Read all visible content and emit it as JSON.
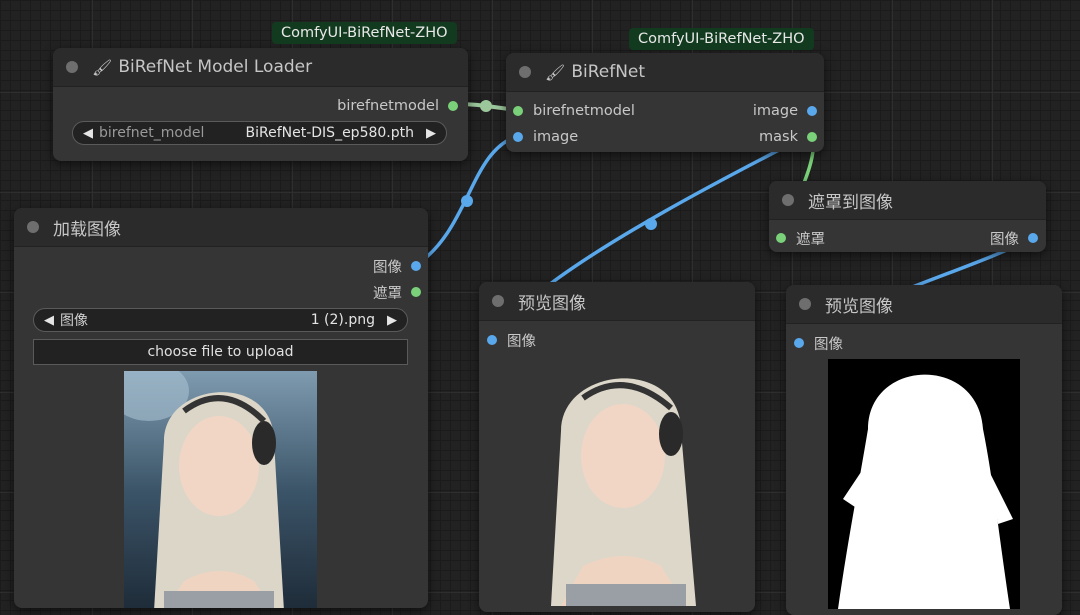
{
  "badges": {
    "loader": "ComfyUI-BiRefNet-ZHO",
    "birefnet": "ComfyUI-BiRefNet-ZHO"
  },
  "loader_node": {
    "title": "BiRefNet Model Loader",
    "output_label": "birefnetmodel",
    "widget_label": "birefnet_model",
    "widget_value": "BiRefNet-DIS_ep580.pth"
  },
  "birefnet_node": {
    "title": "BiRefNet",
    "inputs": [
      "birefnetmodel",
      "image"
    ],
    "outputs": [
      "image",
      "mask"
    ]
  },
  "mask_to_image_node": {
    "title": "遮罩到图像",
    "input_label": "遮罩",
    "output_label": "图像"
  },
  "load_image_node": {
    "title": "加载图像",
    "outputs": [
      "图像",
      "遮罩"
    ],
    "widget_label": "图像",
    "widget_value": "1 (2).png",
    "upload_label": "choose file to upload"
  },
  "preview_node_1": {
    "title": "预览图像",
    "input_label": "图像"
  },
  "preview_node_2": {
    "title": "预览图像",
    "input_label": "图像"
  },
  "colors": {
    "model_link": "#9bc79b",
    "image_link": "#5aa8ec",
    "mask_link": "#7ad17a",
    "badge_bg": "#123a1f"
  }
}
